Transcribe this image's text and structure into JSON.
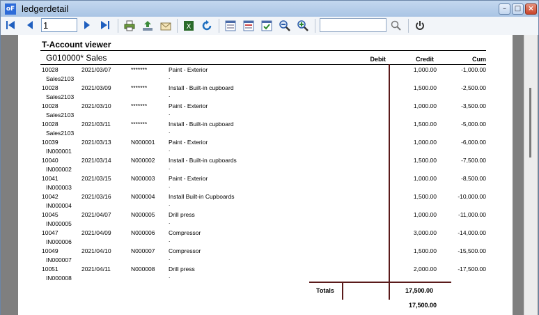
{
  "window": {
    "title": "ledgerdetail",
    "app_icon_text": "oF"
  },
  "toolbar": {
    "page_number": "1",
    "search_value": "",
    "icons": [
      "first-page-icon",
      "prev-page-icon",
      "next-page-icon",
      "last-page-icon",
      "print-icon",
      "export-icon",
      "email-icon",
      "excel-icon",
      "refresh-icon",
      "layout-icon",
      "layout2-icon",
      "layout-check-icon",
      "zoom-out-icon",
      "zoom-in-icon",
      "search-icon",
      "power-icon"
    ]
  },
  "report": {
    "title": "T-Account viewer",
    "account": "G010000* Sales",
    "headers": {
      "debit": "Debit",
      "credit": "Credit",
      "cum": "Cum"
    },
    "rows": [
      {
        "ref": "10028",
        "date": "2021/03/07",
        "doc": "*******",
        "desc": "Paint - Exterior",
        "credit": "1,000.00",
        "cum": "-1,000.00",
        "sub": "Sales2103",
        "dot": "."
      },
      {
        "ref": "10028",
        "date": "2021/03/09",
        "doc": "*******",
        "desc": "Install - Built-in cupboard",
        "credit": "1,500.00",
        "cum": "-2,500.00",
        "sub": "Sales2103",
        "dot": "."
      },
      {
        "ref": "10028",
        "date": "2021/03/10",
        "doc": "*******",
        "desc": "Paint - Exterior",
        "credit": "1,000.00",
        "cum": "-3,500.00",
        "sub": "Sales2103",
        "dot": "."
      },
      {
        "ref": "10028",
        "date": "2021/03/11",
        "doc": "*******",
        "desc": "Install - Built-in cupboard",
        "credit": "1,500.00",
        "cum": "-5,000.00",
        "sub": "Sales2103",
        "dot": "."
      },
      {
        "ref": "10039",
        "date": "2021/03/13",
        "doc": "N000001",
        "desc": "Paint - Exterior",
        "credit": "1,000.00",
        "cum": "-6,000.00",
        "sub": "IN000001",
        "dot": "."
      },
      {
        "ref": "10040",
        "date": "2021/03/14",
        "doc": "N000002",
        "desc": "Install - Built-in cupboards",
        "credit": "1,500.00",
        "cum": "-7,500.00",
        "sub": "IN000002",
        "dot": "."
      },
      {
        "ref": "10041",
        "date": "2021/03/15",
        "doc": "N000003",
        "desc": "Paint - Exterior",
        "credit": "1,000.00",
        "cum": "-8,500.00",
        "sub": "IN000003",
        "dot": "."
      },
      {
        "ref": "10042",
        "date": "2021/03/16",
        "doc": "N000004",
        "desc": "Install Built-in Cupboards",
        "credit": "1,500.00",
        "cum": "-10,000.00",
        "sub": "IN000004",
        "dot": "."
      },
      {
        "ref": "10045",
        "date": "2021/04/07",
        "doc": "N000005",
        "desc": "Drill press",
        "credit": "1,000.00",
        "cum": "-11,000.00",
        "sub": "IN000005",
        "dot": "."
      },
      {
        "ref": "10047",
        "date": "2021/04/09",
        "doc": "N000006",
        "desc": "Compressor",
        "credit": "3,000.00",
        "cum": "-14,000.00",
        "sub": "IN000006",
        "dot": "."
      },
      {
        "ref": "10049",
        "date": "2021/04/10",
        "doc": "N000007",
        "desc": "Compressor",
        "credit": "1,500.00",
        "cum": "-15,500.00",
        "sub": "IN000007",
        "dot": "."
      },
      {
        "ref": "10051",
        "date": "2021/04/11",
        "doc": "N000008",
        "desc": "Drill press",
        "credit": "2,000.00",
        "cum": "-17,500.00",
        "sub": "IN000008",
        "dot": "."
      }
    ],
    "totals": {
      "label": "Totals",
      "credit": "17,500.00",
      "cum": "17,500.00"
    }
  }
}
